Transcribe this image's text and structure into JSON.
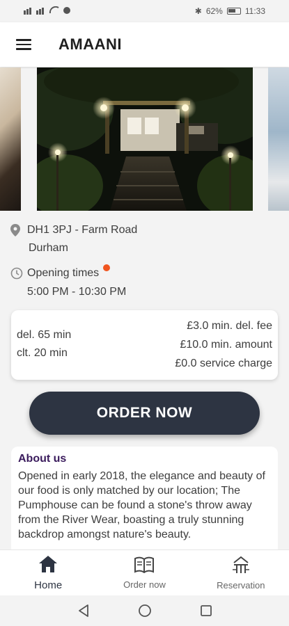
{
  "status_bar": {
    "left_icons": "signal-icons",
    "battery": "62%",
    "time": "11:33"
  },
  "app_bar": {
    "title": "AMAANI",
    "menu_icon": "hamburger-menu-icon"
  },
  "restaurant": {
    "address_line1": "DH1 3PJ - Farm Road",
    "address_line2": "Durham",
    "opening_label": "Opening times",
    "hours": "5:00 PM - 10:30 PM",
    "status_color": "#f0551f"
  },
  "delivery": {
    "del_time": "del. 65 min",
    "clt_time": "clt. 20 min",
    "min_del_fee": "£3.0 min. del. fee",
    "min_amount": "£10.0 min. amount",
    "service_charge": "£0.0 service charge"
  },
  "order_button": {
    "label": "ORDER NOW"
  },
  "about": {
    "heading": "About us",
    "text": "Opened in early 2018, the elegance and beauty of our food is only matched by our location; The Pumphouse can be found a stone's throw away from the River Wear, boasting a truly stunning backdrop amongst nature's beauty."
  },
  "bottom_nav": {
    "items": [
      {
        "label": "Home",
        "icon": "home-icon",
        "active": true
      },
      {
        "label": "Order now",
        "icon": "menu-book-icon",
        "active": false
      },
      {
        "label": "Reservation",
        "icon": "restaurant-icon",
        "active": false
      }
    ]
  },
  "colors": {
    "accent": "#2d3442",
    "about_heading": "#3a1b5c"
  }
}
